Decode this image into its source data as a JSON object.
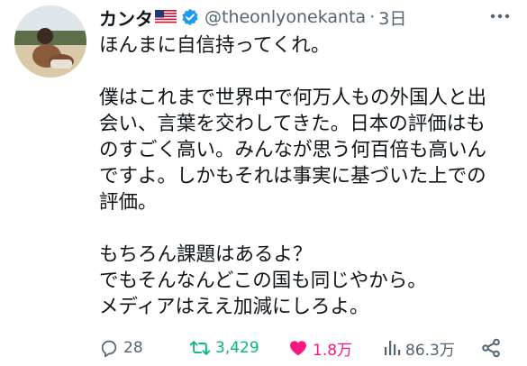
{
  "tweet": {
    "author": {
      "name": "カンタ",
      "flag_icon": "us-flag-icon",
      "verified_icon": "verified-badge-icon",
      "handle": "@theonlyonekanta",
      "separator": "·",
      "time": "3日"
    },
    "body_lines": [
      "ほんまに自信持ってくれ。",
      "",
      "僕はこれまで世界中で何万人もの外国人と出",
      "会い、言葉を交わしてきた。日本の評価はも",
      "のすごく高い。みんなが思う何百倍も高いん",
      "ですよ。しかもそれは事実に基づいた上での",
      "評価。",
      "",
      "もちろん課題はあるよ？",
      "でもそんなんどこの国も同じやから。",
      "メディアはええ加減にしろよ。"
    ],
    "actions": {
      "reply_count": "28",
      "retweet_count": "3,429",
      "like_count": "1.8万",
      "views_count": "86.3万"
    }
  },
  "colors": {
    "text": "#0f1419",
    "secondary": "#536471",
    "verified": "#1d9bf0",
    "retweet_active": "#00ba7c",
    "like_active": "#f91880"
  }
}
